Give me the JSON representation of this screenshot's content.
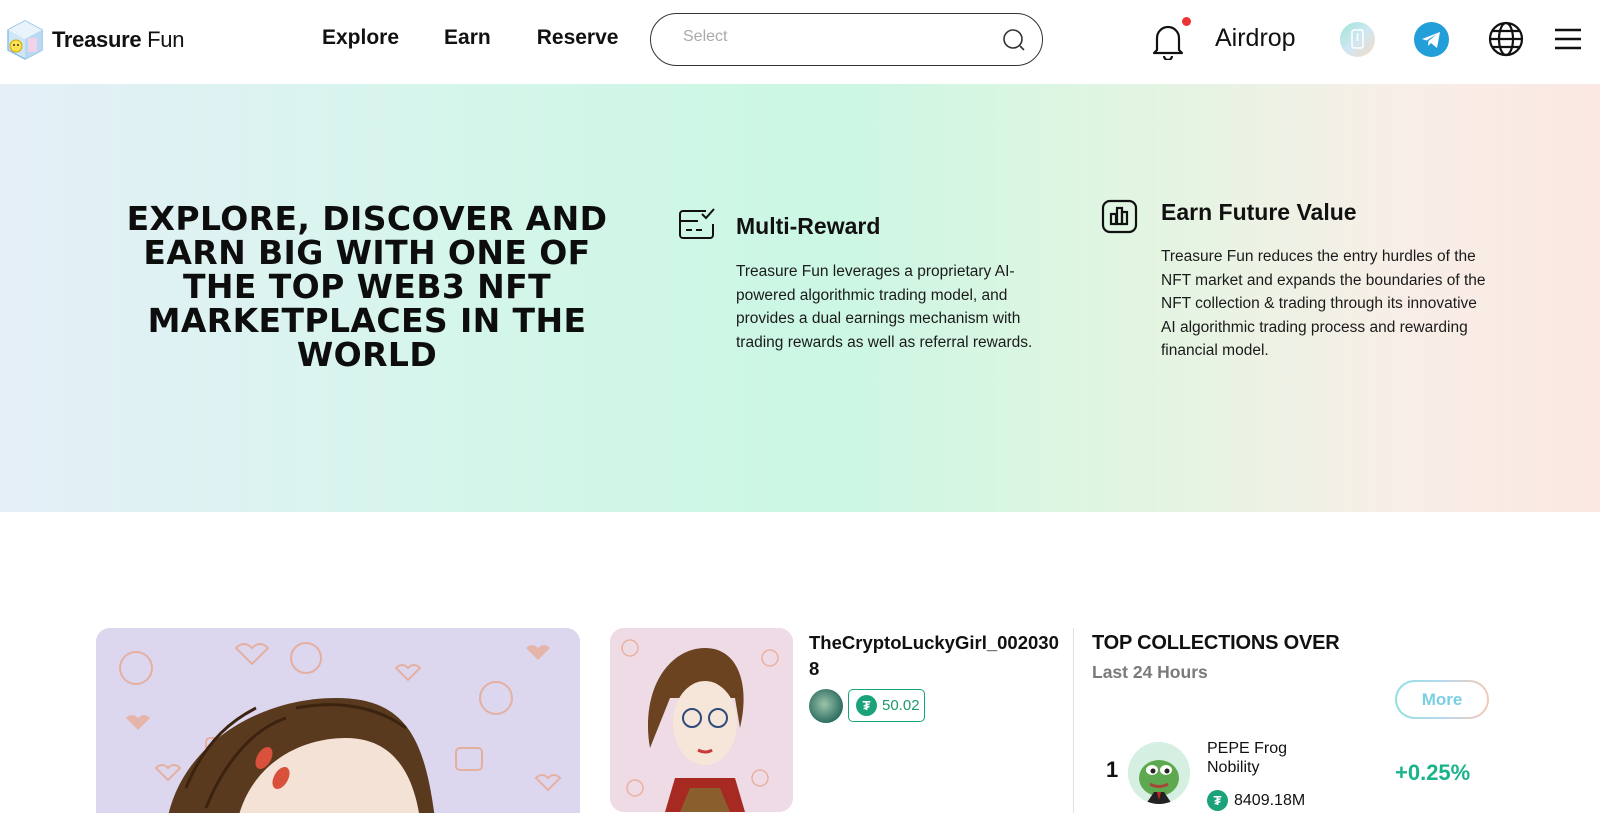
{
  "header": {
    "logo_bold": "Treasure",
    "logo_light": "Fun",
    "nav": [
      "Explore",
      "Earn",
      "Reserve"
    ],
    "search_placeholder": "Select",
    "airdrop": "Airdrop",
    "icons": [
      "bell-icon",
      "app-download-icon",
      "telegram-icon",
      "globe-icon",
      "menu-icon"
    ]
  },
  "hero": {
    "title": "EXPLORE, DISCOVER AND EARN BIG WITH ONE OF THE TOP WEB3 NFT MARKETPLACES IN THE WORLD",
    "features": [
      {
        "icon": "checklist-card-icon",
        "title": "Multi-Reward",
        "text": "Treasure Fun leverages a proprietary AI-powered algorithmic trading model, and provides a dual earnings mechanism with trading rewards as well as referral rewards."
      },
      {
        "icon": "bar-chart-icon",
        "title": "Earn Future Value",
        "text": "Treasure Fun reduces the entry hurdles of the NFT market and expands the boundaries of the NFT collection & trading through its innovative AI algorithmic trading process and rewarding financial model."
      }
    ]
  },
  "featured_nft": {
    "name": "TheCryptoLuckyGirl_0020308",
    "price": "50.02",
    "currency_symbol": "₮"
  },
  "top_collections": {
    "title": "TOP COLLECTIONS OVER",
    "subtitle": "Last 24 Hours",
    "more": "More",
    "items": [
      {
        "rank": "1",
        "name": "PEPE Frog Nobility",
        "volume": "8409.18M",
        "change": "+0.25%"
      }
    ]
  },
  "colors": {
    "accent_green": "#1ab38a",
    "telegram_blue": "#229ed9",
    "notification_red": "#e33333"
  }
}
